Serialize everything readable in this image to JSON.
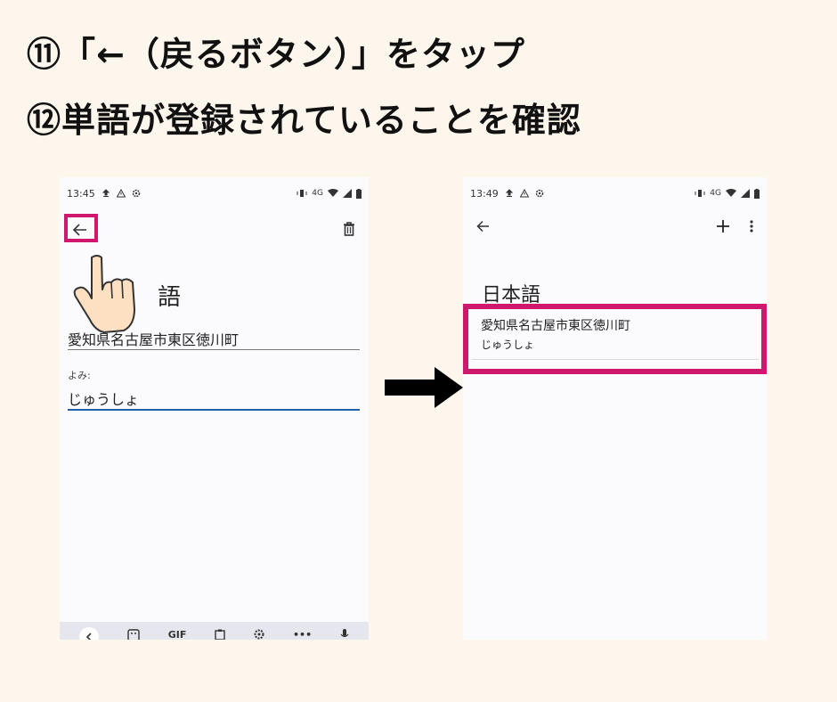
{
  "instructions": {
    "step11": "⑪「←（戻るボタン）」をタップ",
    "step12": "⑫単語が登録されていることを確認"
  },
  "left_screen": {
    "status_time": "13:45",
    "status_network": "4G",
    "language_title_partial": "語",
    "word_value": "愛知県名古屋市東区徳川町",
    "yomi_label": "よみ:",
    "yomi_value": "じゅうしょ",
    "keyboard": {
      "gif_label": "GIF",
      "more_label": "•••"
    },
    "icons": [
      "arrow-back-icon",
      "trash-icon",
      "upload-icon",
      "warning-icon",
      "gear-icon",
      "vibrate-icon",
      "wifi-icon",
      "signal-icon",
      "battery-icon",
      "pointing-hand-icon"
    ]
  },
  "right_screen": {
    "status_time": "13:49",
    "status_network": "4G",
    "language_title": "日本語",
    "entries": [
      {
        "word": "愛知県名古屋市東区徳川町",
        "yomi": "じゅうしょ"
      }
    ],
    "icons": [
      "arrow-back-icon",
      "add-icon",
      "more-vert-icon"
    ]
  },
  "colors": {
    "background": "#fdf6ec",
    "highlight": "#d0176e",
    "focus_underline": "#1d5fa8"
  }
}
